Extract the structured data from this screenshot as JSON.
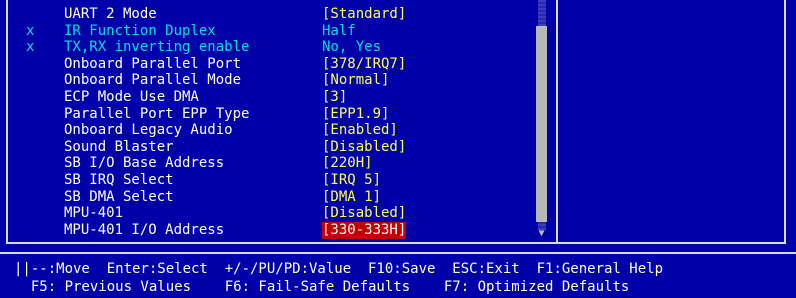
{
  "settings": [
    {
      "marker": "",
      "label": "UART 2 Mode",
      "value": "[Standard]",
      "state": "normal"
    },
    {
      "marker": "x",
      "label": "IR Function Duplex",
      "value": "Half",
      "state": "disabled"
    },
    {
      "marker": "x",
      "label": "TX,RX inverting enable",
      "value": "No, Yes",
      "state": "disabled"
    },
    {
      "marker": "",
      "label": "Onboard Parallel Port",
      "value": "[378/IRQ7]",
      "state": "normal"
    },
    {
      "marker": "",
      "label": "Onboard Parallel Mode",
      "value": "[Normal]",
      "state": "normal"
    },
    {
      "marker": "",
      "label": "ECP Mode Use DMA",
      "value": "[3]",
      "state": "normal"
    },
    {
      "marker": "",
      "label": "Parallel Port EPP Type",
      "value": "[EPP1.9]",
      "state": "normal"
    },
    {
      "marker": "",
      "label": "Onboard Legacy Audio",
      "value": "[Enabled]",
      "state": "normal"
    },
    {
      "marker": "",
      "label": "Sound Blaster",
      "value": "[Disabled]",
      "state": "normal"
    },
    {
      "marker": "",
      "label": "SB I/O Base Address",
      "value": "[220H]",
      "state": "normal"
    },
    {
      "marker": "",
      "label": "SB IRQ Select",
      "value": "[IRQ 5]",
      "state": "normal"
    },
    {
      "marker": "",
      "label": "SB DMA Select",
      "value": "[DMA 1]",
      "state": "normal"
    },
    {
      "marker": "",
      "label": "MPU-401",
      "value": "[Disabled]",
      "state": "normal"
    },
    {
      "marker": "",
      "label": "MPU-401 I/O Address",
      "value": "[330-333H]",
      "state": "selected"
    }
  ],
  "scrollbar": {
    "down_arrow": "▼"
  },
  "footer": {
    "line1": "||--:Move  Enter:Select  +/-/PU/PD:Value  F10:Save  ESC:Exit  F1:General Help",
    "line2": "  F5: Previous Values    F6: Fail-Safe Defaults    F7: Optimized Defaults"
  },
  "colors": {
    "background": "#0000a8",
    "value": "#ffff55",
    "disabled": "#00e0e0",
    "selected_bg": "#c00000"
  }
}
